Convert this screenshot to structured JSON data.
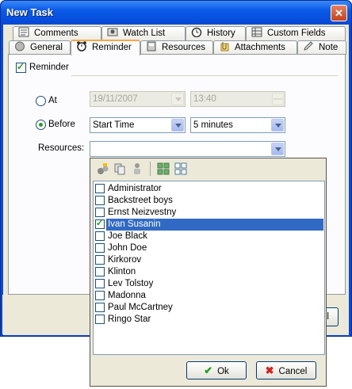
{
  "window": {
    "title": "New Task",
    "close_glyph": "✕"
  },
  "tabs_row1": [
    {
      "label": "Comments",
      "icon": "comments-icon"
    },
    {
      "label": "Watch List",
      "icon": "watch-list-icon"
    },
    {
      "label": "History",
      "icon": "history-icon"
    },
    {
      "label": "Custom Fields",
      "icon": "custom-fields-icon"
    }
  ],
  "tabs_row2": [
    {
      "label": "General",
      "icon": "general-icon"
    },
    {
      "label": "Reminder",
      "icon": "alarm-clock-icon",
      "active": true
    },
    {
      "label": "Resources",
      "icon": "resources-icon"
    },
    {
      "label": "Attachments",
      "icon": "paperclip-icon"
    },
    {
      "label": "Note",
      "icon": "note-icon"
    }
  ],
  "reminder": {
    "enabled_label": "Reminder",
    "enabled": true,
    "at_label": "At",
    "at_date": "19/11/2007",
    "at_time": "13:40",
    "before_label": "Before",
    "before_selected": true,
    "before_anchor": "Start Time",
    "before_offset": "5 minutes",
    "resources_label": "Resources:",
    "resources_value": ""
  },
  "partial_button_label": "el",
  "resources_popup": {
    "items": [
      {
        "name": "Administrator",
        "checked": false
      },
      {
        "name": "Backstreet boys",
        "checked": false
      },
      {
        "name": "Ernst Neizvestny",
        "checked": false
      },
      {
        "name": "Ivan Susanin",
        "checked": true,
        "selected": true
      },
      {
        "name": "Joe Black",
        "checked": false
      },
      {
        "name": "John Doe",
        "checked": false
      },
      {
        "name": "Kirkorov",
        "checked": false
      },
      {
        "name": "Klinton",
        "checked": false
      },
      {
        "name": "Lev Tolstoy",
        "checked": false
      },
      {
        "name": "Madonna",
        "checked": false
      },
      {
        "name": "Paul McCartney",
        "checked": false
      },
      {
        "name": "Ringo Star",
        "checked": false
      }
    ],
    "ok_label": "Ok",
    "cancel_label": "Cancel",
    "colors": {
      "selection": "#316ac5",
      "check": "#21a121",
      "cancel_icon": "#d42020"
    }
  }
}
